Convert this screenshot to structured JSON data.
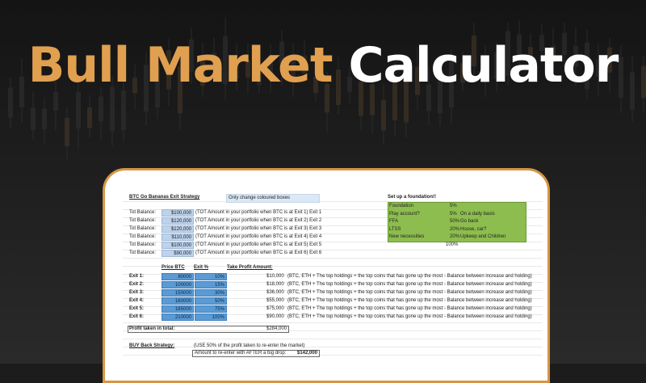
{
  "header": {
    "title_accent": "Bull Market",
    "title_main": "Calculator"
  },
  "sheet": {
    "strategy_title": "BTC Go Bananas Exit Strategy",
    "note": "Only change coloured boxes",
    "balances": [
      {
        "label": "Tot Balance:",
        "value": "$100,000",
        "desc": "(TOT Amount in your portfolio when BTC is at Exit 1) Exit 1"
      },
      {
        "label": "Tot Balance:",
        "value": "$120,000",
        "desc": "(TOT Amount in your portfolio when BTC is at Exit 2) Exit 2"
      },
      {
        "label": "Tot Balance:",
        "value": "$120,000",
        "desc": "(TOT Amount in your portfolio when BTC is at Exit 3) Exit 3"
      },
      {
        "label": "Tot Balance:",
        "value": "$110,000",
        "desc": "(TOT Amount in your portfolio when BTC is at Exit 4) Exit 4"
      },
      {
        "label": "Tot Balance:",
        "value": "$100,000",
        "desc": "(TOT Amount in your portfolio when BTC is at Exit 5) Exit 5"
      },
      {
        "label": "Tot Balance:",
        "value": "$90,000",
        "desc": "(TOT Amount in your portfolio when BTC is at Exit 6) Exit 6"
      }
    ],
    "foundation": {
      "title": "Set up a foundation!!",
      "rows": [
        {
          "name": "Foundation",
          "pct": "5%",
          "note": ""
        },
        {
          "name": "Play account?",
          "pct": "5%",
          "note": "On a daily basis"
        },
        {
          "name": "FFA",
          "pct": "50%",
          "note": "Go back"
        },
        {
          "name": "LTSS",
          "pct": "20%",
          "note": "House, car?"
        },
        {
          "name": "New necessities",
          "pct": "20%",
          "note": "Upkeep and Children"
        }
      ],
      "total": "100%"
    },
    "exit_headers": {
      "price": "Price BTC",
      "exit": "Exit %",
      "take": "Take Profit Amount:"
    },
    "exits": [
      {
        "label": "Exit 1:",
        "price": "80000",
        "pct": "10%",
        "amount": "$10,000",
        "desc": "(BTC, ETH + The top holdings + the top coins that has gone up the most - Balance between increase and holding)"
      },
      {
        "label": "Exit 2:",
        "price": "100000",
        "pct": "15%",
        "amount": "$18,000",
        "desc": "(BTC, ETH + The top holdings + the top coins that has gone up the most - Balance between increase and holding)"
      },
      {
        "label": "Exit 3:",
        "price": "150000",
        "pct": "30%",
        "amount": "$36,000",
        "desc": "(BTC, ETH + The top holdings + the top coins that has gone up the most - Balance between increase and holding)"
      },
      {
        "label": "Exit 4:",
        "price": "160000",
        "pct": "50%",
        "amount": "$55,000",
        "desc": "(BTC, ETH + The top holdings + the top coins that has gone up the most - Balance between increase and holding)"
      },
      {
        "label": "Exit 5:",
        "price": "185000",
        "pct": "75%",
        "amount": "$75,000",
        "desc": "(BTC, ETH + The top holdings + the top coins that has gone up the most - Balance between increase and holding)"
      },
      {
        "label": "Exit 6:",
        "price": "210000",
        "pct": "100%",
        "amount": "$90,000",
        "desc": "(BTC, ETH + The top holdings + the top coins that has gone up the most - Balance between increase and holding)"
      }
    ],
    "profit": {
      "label": "Profit taken in total:",
      "value": "$284,000"
    },
    "buyback": {
      "label": "BUY Back Strategy:",
      "note": "(USE 50% of the profit taken to re-enter the market)",
      "reenter_label": "Amount to re-enter with AFTER a big drop:",
      "reenter_value": "$142,000"
    }
  }
}
